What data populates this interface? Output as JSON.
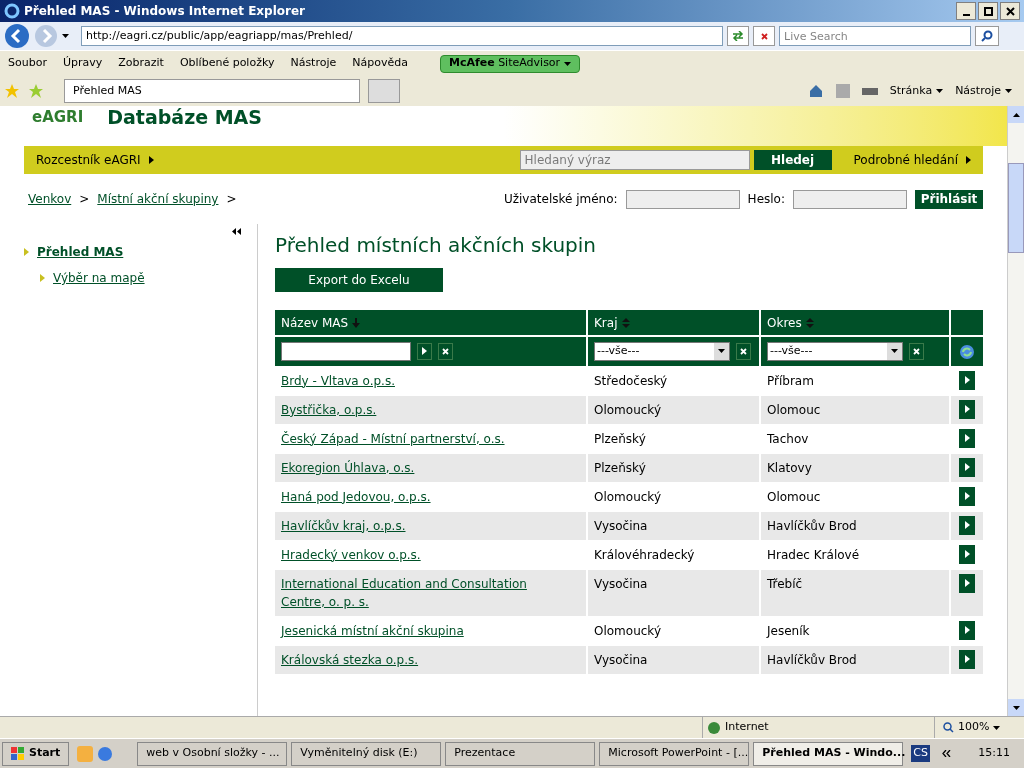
{
  "window": {
    "title": "Přehled MAS - Windows Internet Explorer"
  },
  "address": {
    "url": "http://eagri.cz/public/app/eagriapp/mas/Prehled/"
  },
  "search": {
    "placeholder": "Live Search"
  },
  "menu": [
    "Soubor",
    "Úpravy",
    "Zobrazit",
    "Oblíbené položky",
    "Nástroje",
    "Nápověda"
  ],
  "addon": {
    "label_bold": "McAfee",
    "label": "SiteAdvisor"
  },
  "tabs": [
    {
      "label": "Přehled MAS",
      "selected": true
    }
  ],
  "toolbar": [
    "Stránka",
    "Nástroje"
  ],
  "site": {
    "logo": "eAGRI",
    "title": "Databáze MAS"
  },
  "nav": {
    "left": "Rozcestník eAGRI",
    "search_placeholder": "Hledaný výraz",
    "search_button": "Hledej",
    "right": "Podrobné hledání"
  },
  "breadcrumb": [
    {
      "label": "Venkov",
      "separator": ">"
    },
    {
      "label": "Místní akční skupiny",
      "separator": ">"
    }
  ],
  "login": {
    "user_label": "Uživatelské jméno:",
    "password_label": "Heslo:",
    "button": "Přihlásit"
  },
  "sidebar": {
    "items": [
      {
        "label": "Přehled MAS",
        "selected": true,
        "children": [
          {
            "label": "Výběr na mapě",
            "selected": false
          }
        ]
      }
    ]
  },
  "heading": "Přehled místních akčních skupin",
  "export_button": "Export do Excelu",
  "table": {
    "columns": [
      {
        "label": "Název MAS",
        "kind": "sorted"
      },
      {
        "label": "Kraj",
        "kind": "sortable"
      },
      {
        "label": "Okres",
        "kind": "sortable"
      }
    ],
    "filters": [
      {
        "kind": "text"
      },
      {
        "kind": "select",
        "value": "---vše---"
      },
      {
        "kind": "select",
        "value": "---vše---"
      }
    ],
    "rows": [
      {
        "name": "Brdy - Vltava o.p.s.",
        "kraj": "Středočeský",
        "okres": "Příbram"
      },
      {
        "name": "Bystřička, o.p.s.",
        "kraj": "Olomoucký",
        "okres": "Olomouc"
      },
      {
        "name": "Český Západ - Místní partnerství, o.s.",
        "kraj": "Plzeňský",
        "okres": "Tachov"
      },
      {
        "name": "Ekoregion Úhlava, o.s.",
        "kraj": "Plzeňský",
        "okres": "Klatovy"
      },
      {
        "name": "Haná pod Jedovou, o.p.s.",
        "kraj": "Olomoucký",
        "okres": "Olomouc"
      },
      {
        "name": "Havlíčkův kraj, o.p.s.",
        "kraj": "Vysočina",
        "okres": "Havlíčkův Brod"
      },
      {
        "name": "Hradecký venkov o.p.s.",
        "kraj": "Královéhradecký",
        "okres": "Hradec Králové"
      },
      {
        "name": "International Education and Consultation Centre, o. p. s.",
        "kraj": "Vysočina",
        "okres": "Třebíč"
      },
      {
        "name": "Jesenická místní akční skupina",
        "kraj": "Olomoucký",
        "okres": "Jeseník"
      },
      {
        "name": "Královská stezka o.p.s.",
        "kraj": "Vysočina",
        "okres": "Havlíčkův Brod"
      }
    ]
  },
  "status_bar": {
    "zone": "Internet",
    "zoom": "100%"
  },
  "taskbar": {
    "start": "Start",
    "items": [
      {
        "label": "web v Osobní složky - ...",
        "selected": false
      },
      {
        "label": "Vyměnitelný disk (E:)",
        "selected": false
      },
      {
        "label": "Prezentace",
        "selected": false
      },
      {
        "label": "Microsoft PowerPoint - [...",
        "selected": false
      },
      {
        "label": "Přehled MAS - Windo...",
        "selected": true
      }
    ],
    "lang": "CS",
    "clock": "15:11"
  }
}
